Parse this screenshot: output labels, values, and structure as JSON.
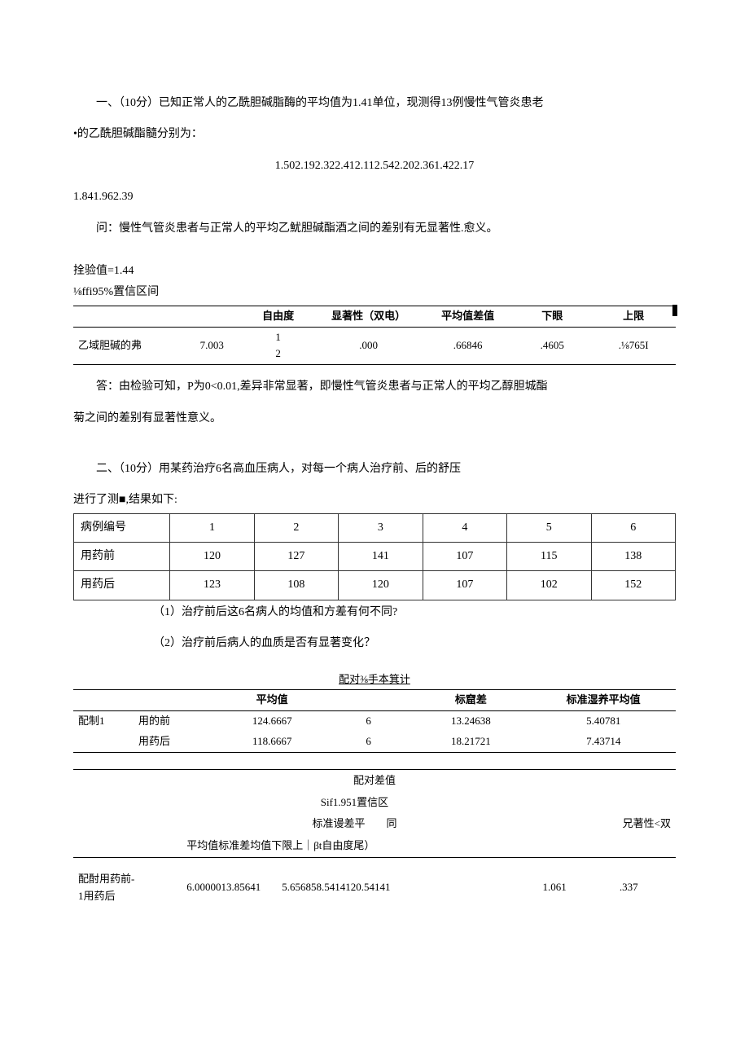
{
  "q1": {
    "prompt_line1": "一、（10分）已知正常人的乙酰胆碱脂酶的平均值为1.41单位，现测得13例慢性气管炎患老",
    "prompt_line2": "•的乙酰胆碱酯髓分别为：",
    "data_line1": "1.502.192.322.412.112.542.202.361.422.17",
    "data_line2": "1.841.962.39",
    "question": "问：慢性气管炎患者与正常人的平均乙魷胆碱酯酒之间的差别有无显著性.愈义。",
    "test_value": "拴验值=1.44",
    "ci_label": "⅛ffi95%置信区间",
    "tbl_headers": [
      "",
      "",
      "自由度",
      "显著性（双电）",
      "平均值差值",
      "下眼",
      "上限"
    ],
    "tbl_row": [
      "乙域胆碱的弗",
      "7.003",
      "1\n2",
      ".000",
      ".66846",
      ".4605",
      ".⅛765I"
    ],
    "answer_line1": "答：由检验可知，P为0<0.01,差异非常显著，即慢性气管炎患者与正常人的平均乙醇胆城酯",
    "answer_line2": "菊之间的差别有显著性意义。"
  },
  "q2": {
    "prompt_line1": "二、（10分）用某药治疗6名高血压病人，对每一个病人治疗前、后的舒压",
    "prompt_line2": "进行了测■,结果如下:",
    "headers": [
      "病例编号",
      "1",
      "2",
      "3",
      "4",
      "5",
      "6"
    ],
    "rows": [
      {
        "label": "用药前",
        "vals": [
          "120",
          "127",
          "141",
          "107",
          "115",
          "138"
        ]
      },
      {
        "label": "用药后",
        "vals": [
          "123",
          "108",
          "120",
          "107",
          "102",
          "152"
        ]
      }
    ],
    "sub1": "（1）治疗前后这6名病人的均值和方差有何不同?",
    "sub2": "（2）治疗前后病人的血质是否有显著变化？",
    "stats_title": "配对⅜手本箕计",
    "stats_headers": [
      "",
      "",
      "平均值",
      "",
      "标窟差",
      "标准湿养平均值"
    ],
    "stats_rows": [
      {
        "g": "配制1",
        "label": "用的前",
        "mean": "124.6667",
        "n": "6",
        "sd": "13.24638",
        "sem": "5.40781"
      },
      {
        "g": "",
        "label": "用药后",
        "mean": "118.6667",
        "n": "6",
        "sd": "18.21721",
        "sem": "7.43714"
      }
    ],
    "diff_title": "配对差值",
    "diff_ci": "Sif1.951置信区",
    "diff_hdr2": "标准谩差平        同",
    "diff_hdr3": "平均值标准差均值下限上｜βt自由度尾）",
    "diff_right": "兄著性<双",
    "diff_row": {
      "label": "配酎用药前-\n1用药后",
      "vals": "6.0000013.85641        5.656858.5414120.54141",
      "t": "1.061",
      "sig": ".337"
    }
  }
}
